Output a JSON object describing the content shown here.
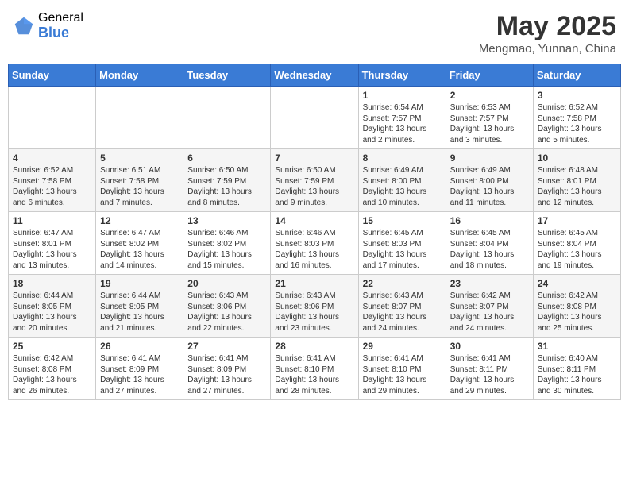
{
  "header": {
    "logo_general": "General",
    "logo_blue": "Blue",
    "month_title": "May 2025",
    "location": "Mengmao, Yunnan, China"
  },
  "weekdays": [
    "Sunday",
    "Monday",
    "Tuesday",
    "Wednesday",
    "Thursday",
    "Friday",
    "Saturday"
  ],
  "weeks": [
    [
      {
        "day": "",
        "info": ""
      },
      {
        "day": "",
        "info": ""
      },
      {
        "day": "",
        "info": ""
      },
      {
        "day": "",
        "info": ""
      },
      {
        "day": "1",
        "info": "Sunrise: 6:54 AM\nSunset: 7:57 PM\nDaylight: 13 hours\nand 2 minutes."
      },
      {
        "day": "2",
        "info": "Sunrise: 6:53 AM\nSunset: 7:57 PM\nDaylight: 13 hours\nand 3 minutes."
      },
      {
        "day": "3",
        "info": "Sunrise: 6:52 AM\nSunset: 7:58 PM\nDaylight: 13 hours\nand 5 minutes."
      }
    ],
    [
      {
        "day": "4",
        "info": "Sunrise: 6:52 AM\nSunset: 7:58 PM\nDaylight: 13 hours\nand 6 minutes."
      },
      {
        "day": "5",
        "info": "Sunrise: 6:51 AM\nSunset: 7:58 PM\nDaylight: 13 hours\nand 7 minutes."
      },
      {
        "day": "6",
        "info": "Sunrise: 6:50 AM\nSunset: 7:59 PM\nDaylight: 13 hours\nand 8 minutes."
      },
      {
        "day": "7",
        "info": "Sunrise: 6:50 AM\nSunset: 7:59 PM\nDaylight: 13 hours\nand 9 minutes."
      },
      {
        "day": "8",
        "info": "Sunrise: 6:49 AM\nSunset: 8:00 PM\nDaylight: 13 hours\nand 10 minutes."
      },
      {
        "day": "9",
        "info": "Sunrise: 6:49 AM\nSunset: 8:00 PM\nDaylight: 13 hours\nand 11 minutes."
      },
      {
        "day": "10",
        "info": "Sunrise: 6:48 AM\nSunset: 8:01 PM\nDaylight: 13 hours\nand 12 minutes."
      }
    ],
    [
      {
        "day": "11",
        "info": "Sunrise: 6:47 AM\nSunset: 8:01 PM\nDaylight: 13 hours\nand 13 minutes."
      },
      {
        "day": "12",
        "info": "Sunrise: 6:47 AM\nSunset: 8:02 PM\nDaylight: 13 hours\nand 14 minutes."
      },
      {
        "day": "13",
        "info": "Sunrise: 6:46 AM\nSunset: 8:02 PM\nDaylight: 13 hours\nand 15 minutes."
      },
      {
        "day": "14",
        "info": "Sunrise: 6:46 AM\nSunset: 8:03 PM\nDaylight: 13 hours\nand 16 minutes."
      },
      {
        "day": "15",
        "info": "Sunrise: 6:45 AM\nSunset: 8:03 PM\nDaylight: 13 hours\nand 17 minutes."
      },
      {
        "day": "16",
        "info": "Sunrise: 6:45 AM\nSunset: 8:04 PM\nDaylight: 13 hours\nand 18 minutes."
      },
      {
        "day": "17",
        "info": "Sunrise: 6:45 AM\nSunset: 8:04 PM\nDaylight: 13 hours\nand 19 minutes."
      }
    ],
    [
      {
        "day": "18",
        "info": "Sunrise: 6:44 AM\nSunset: 8:05 PM\nDaylight: 13 hours\nand 20 minutes."
      },
      {
        "day": "19",
        "info": "Sunrise: 6:44 AM\nSunset: 8:05 PM\nDaylight: 13 hours\nand 21 minutes."
      },
      {
        "day": "20",
        "info": "Sunrise: 6:43 AM\nSunset: 8:06 PM\nDaylight: 13 hours\nand 22 minutes."
      },
      {
        "day": "21",
        "info": "Sunrise: 6:43 AM\nSunset: 8:06 PM\nDaylight: 13 hours\nand 23 minutes."
      },
      {
        "day": "22",
        "info": "Sunrise: 6:43 AM\nSunset: 8:07 PM\nDaylight: 13 hours\nand 24 minutes."
      },
      {
        "day": "23",
        "info": "Sunrise: 6:42 AM\nSunset: 8:07 PM\nDaylight: 13 hours\nand 24 minutes."
      },
      {
        "day": "24",
        "info": "Sunrise: 6:42 AM\nSunset: 8:08 PM\nDaylight: 13 hours\nand 25 minutes."
      }
    ],
    [
      {
        "day": "25",
        "info": "Sunrise: 6:42 AM\nSunset: 8:08 PM\nDaylight: 13 hours\nand 26 minutes."
      },
      {
        "day": "26",
        "info": "Sunrise: 6:41 AM\nSunset: 8:09 PM\nDaylight: 13 hours\nand 27 minutes."
      },
      {
        "day": "27",
        "info": "Sunrise: 6:41 AM\nSunset: 8:09 PM\nDaylight: 13 hours\nand 27 minutes."
      },
      {
        "day": "28",
        "info": "Sunrise: 6:41 AM\nSunset: 8:10 PM\nDaylight: 13 hours\nand 28 minutes."
      },
      {
        "day": "29",
        "info": "Sunrise: 6:41 AM\nSunset: 8:10 PM\nDaylight: 13 hours\nand 29 minutes."
      },
      {
        "day": "30",
        "info": "Sunrise: 6:41 AM\nSunset: 8:11 PM\nDaylight: 13 hours\nand 29 minutes."
      },
      {
        "day": "31",
        "info": "Sunrise: 6:40 AM\nSunset: 8:11 PM\nDaylight: 13 hours\nand 30 minutes."
      }
    ]
  ]
}
